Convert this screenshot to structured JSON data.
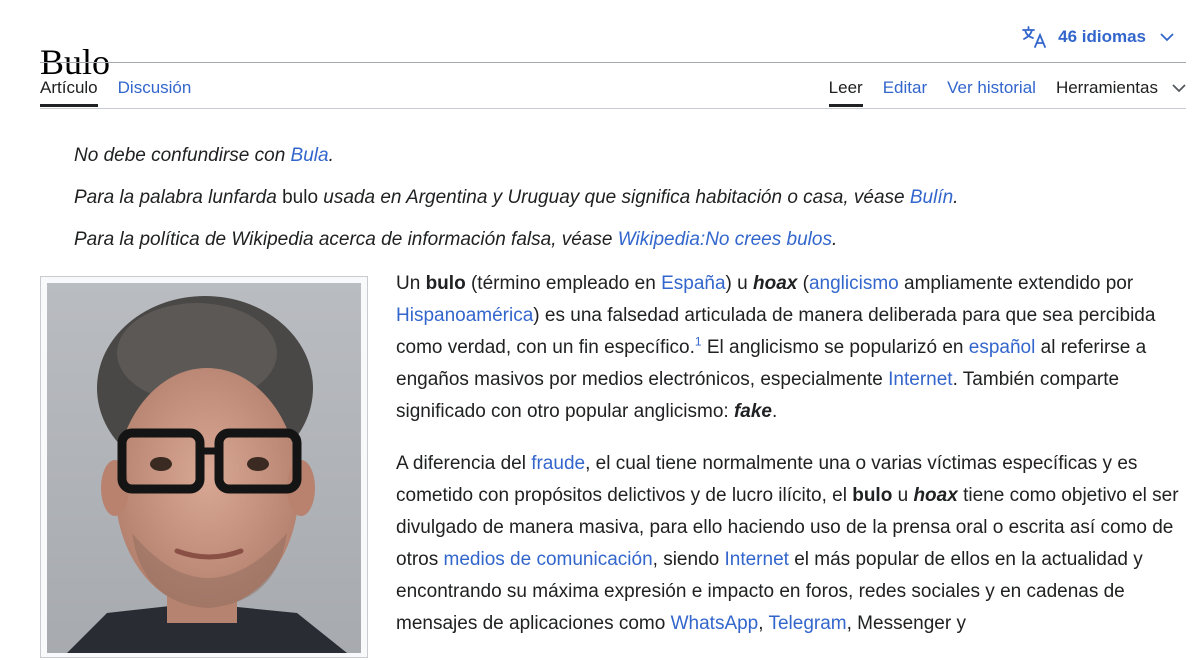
{
  "header": {
    "title": "Bulo",
    "languages_label": "46 idiomas"
  },
  "tabs": {
    "left": [
      "Artículo",
      "Discusión"
    ],
    "right": [
      "Leer",
      "Editar",
      "Ver historial"
    ],
    "tools": "Herramientas"
  },
  "hatnotes": {
    "n1": {
      "pre": "No debe confundirse con ",
      "link": "Bula",
      "post": "."
    },
    "n2": {
      "pre": "Para la palabra lunfarda ",
      "word": "bulo",
      "mid": " usada en Argentina y Uruguay que significa habitación o casa, véase ",
      "link": "Bulín",
      "post": "."
    },
    "n3": {
      "pre": "Para la política de Wikipedia acerca de información falsa, véase ",
      "link": "Wikipedia:No crees bulos",
      "post": "."
    }
  },
  "body": {
    "p1": {
      "t1": "Un ",
      "b1": "bulo",
      "t2": " (término empleado en ",
      "l1": "España",
      "t3": ") u ",
      "b2": "hoax",
      "t4": " (",
      "l2": "anglicismo",
      "t5": " ampliamente extendido por ",
      "l3": "Hispanoamérica",
      "t6": ") es una falsedad articulada de manera deliberada para que sea percibida como verdad, con un fin específico.",
      "ref": "1",
      "t7": "  El anglicismo se popularizó en ",
      "l4": "español",
      "t8": " al referirse a engaños masivos por medios electrónicos, especialmente ",
      "l5": "Internet",
      "t9": ". También comparte significado con otro popular anglicismo: ",
      "b3": "fake",
      "t10": "."
    },
    "p2": {
      "t1": "A diferencia del ",
      "l1": "fraude",
      "t2": ", el cual tiene normalmente una o varias víctimas específicas y es cometido con propósitos delictivos y de lucro ilícito, el ",
      "b1": "bulo",
      "t3": " u ",
      "b2": "hoax",
      "t4": " tiene como objetivo el ser divulgado de manera masiva, para ello haciendo uso de la prensa oral o escrita así como de otros ",
      "l2": "medios de comunicación",
      "t5": ", siendo ",
      "l3": "Internet",
      "t6": " el más popular de ellos en la actualidad y encontrando su máxima expresión e impacto en foros, redes sociales y en cadenas de mensajes de aplicaciones como ",
      "l4": "WhatsApp",
      "t7": ", ",
      "l5": "Telegram",
      "t8": ", Messenger y"
    }
  },
  "colors": {
    "link": "#3366cc",
    "text": "#202122",
    "rule": "#a2a9b1"
  }
}
